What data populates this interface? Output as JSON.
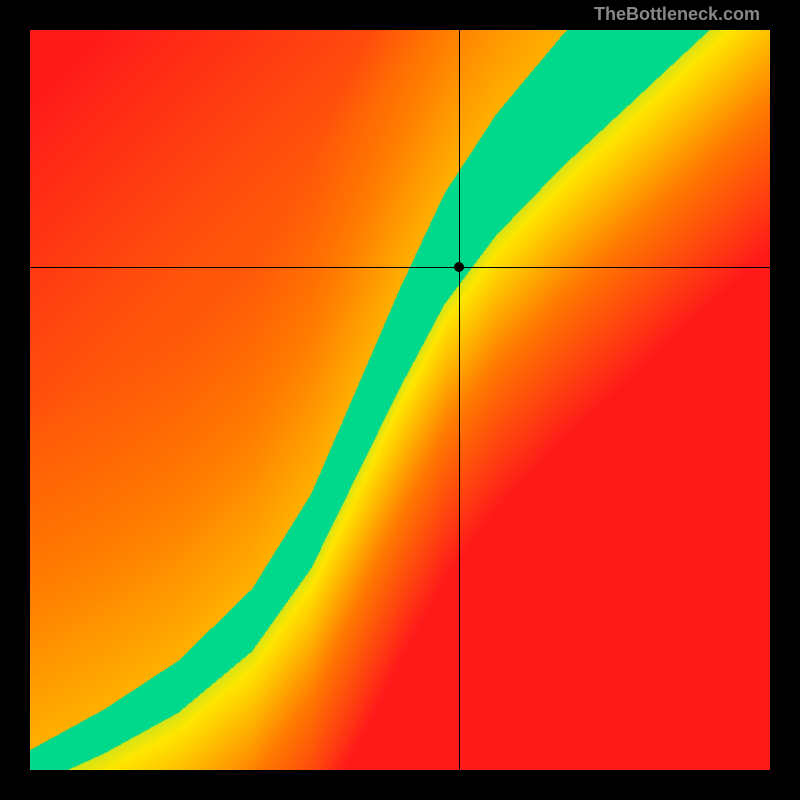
{
  "watermark": "TheBottleneck.com",
  "chart_data": {
    "type": "heatmap",
    "title": "",
    "xlabel": "",
    "ylabel": "",
    "xlim": [
      0,
      1
    ],
    "ylim": [
      0,
      1
    ],
    "marker_point": {
      "x": 0.58,
      "y": 0.68
    },
    "crosshair": {
      "x": 0.58,
      "y": 0.68
    },
    "colormap": {
      "description": "Red-Orange-Yellow-Green gradient where green indicates optimal balance along a diagonal ridge.",
      "stops": [
        {
          "value": 0.0,
          "color": "#ff1a1a"
        },
        {
          "value": 0.4,
          "color": "#ff7a00"
        },
        {
          "value": 0.7,
          "color": "#ffe600"
        },
        {
          "value": 1.0,
          "color": "#00d98b"
        }
      ]
    },
    "ridge": {
      "description": "Optimal (green) ridge path roughly following an S-curve from lower-left to upper-right.",
      "points": [
        {
          "x": 0.0,
          "y": 0.0
        },
        {
          "x": 0.1,
          "y": 0.05
        },
        {
          "x": 0.2,
          "y": 0.11
        },
        {
          "x": 0.3,
          "y": 0.2
        },
        {
          "x": 0.38,
          "y": 0.32
        },
        {
          "x": 0.44,
          "y": 0.45
        },
        {
          "x": 0.5,
          "y": 0.58
        },
        {
          "x": 0.56,
          "y": 0.7
        },
        {
          "x": 0.63,
          "y": 0.8
        },
        {
          "x": 0.72,
          "y": 0.9
        },
        {
          "x": 0.82,
          "y": 1.0
        }
      ]
    },
    "field_description": "2D scalar field: value is high (green) near the ridge curve and falls off toward red away from it. Upper-right side falls off to yellow; lower-left and far upper-left fall off to red."
  }
}
